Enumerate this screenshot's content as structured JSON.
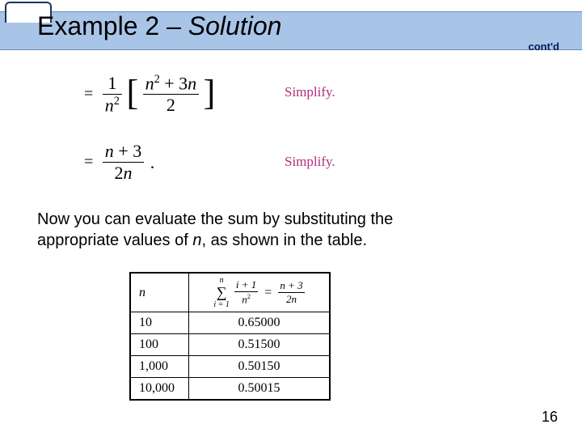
{
  "title": {
    "prefix": "Example 2 – ",
    "solution": "Solution"
  },
  "contd": "cont'd",
  "eq1": {
    "equals": "=",
    "frac1_num": "1",
    "frac1_den_n": "n",
    "frac1_den_exp": "2",
    "lbrack": "[",
    "frac2_num_n": "n",
    "frac2_num_exp": "2",
    "frac2_num_plus": " + 3",
    "frac2_num_n2": "n",
    "frac2_den": "2",
    "rbrack": "]"
  },
  "simplify": "Simplify.",
  "eq2": {
    "equals": "=",
    "num_n": "n",
    "num_rest": " + 3",
    "den_two": "2",
    "den_n": "n",
    "dot": "."
  },
  "body": {
    "line1": "Now you can evaluate the sum by substituting the",
    "line2a": "appropriate values of ",
    "line2n": "n",
    "line2b": ", as shown in the table."
  },
  "table": {
    "hdr_n": "n",
    "sum_top": "n",
    "sum_bottom": "i = 1",
    "sigma": "∑",
    "f1_num": "i + 1",
    "f1_den": "n",
    "f1_den_exp": "2",
    "eq": "=",
    "f2_num": "n + 3",
    "f2_den": "2n",
    "rows": [
      {
        "n": "10",
        "v": "0.65000"
      },
      {
        "n": "100",
        "v": "0.51500"
      },
      {
        "n": "1,000",
        "v": "0.50150"
      },
      {
        "n": "10,000",
        "v": "0.50015"
      }
    ]
  },
  "page": "16"
}
